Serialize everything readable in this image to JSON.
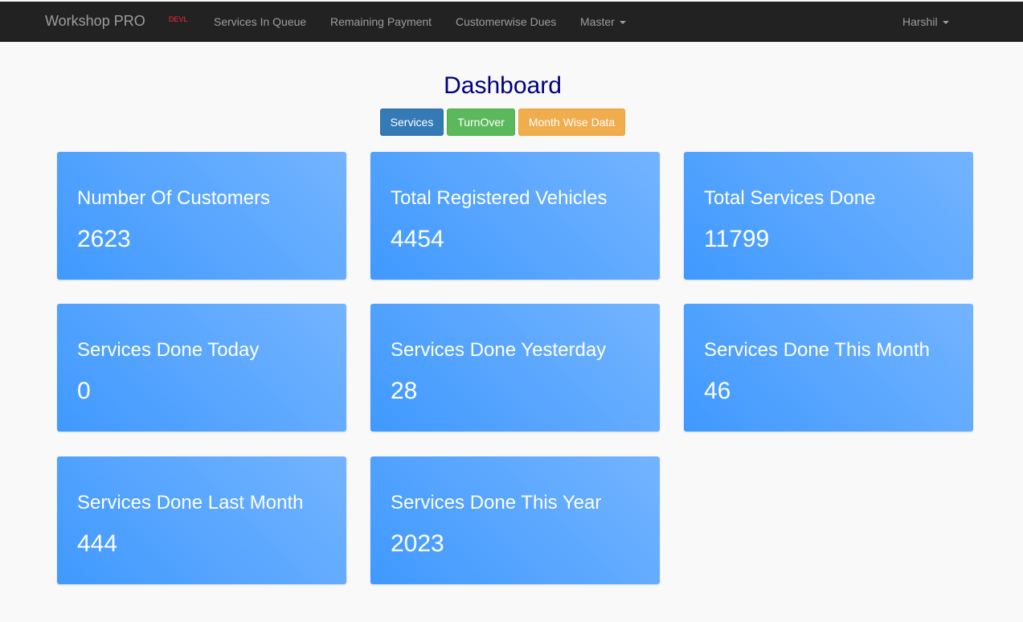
{
  "navbar": {
    "brand": "Workshop PRO",
    "env_badge": "DEVL",
    "links": [
      {
        "label": "Services In Queue"
      },
      {
        "label": "Remaining Payment"
      },
      {
        "label": "Customerwise Dues"
      },
      {
        "label": "Master"
      }
    ],
    "user": "Harshil"
  },
  "page": {
    "title": "Dashboard"
  },
  "buttons": {
    "services": "Services",
    "turnover": "TurnOver",
    "month_wise": "Month Wise Data"
  },
  "cards": [
    {
      "title": "Number Of Customers",
      "value": "2623"
    },
    {
      "title": "Total Registered Vehicles",
      "value": "4454"
    },
    {
      "title": "Total Services Done",
      "value": "11799"
    },
    {
      "title": "Services Done Today",
      "value": "0"
    },
    {
      "title": "Services Done Yesterday",
      "value": "28"
    },
    {
      "title": "Services Done This Month",
      "value": "46"
    },
    {
      "title": "Services Done Last Month",
      "value": "444"
    },
    {
      "title": "Services Done This Year",
      "value": "2023"
    }
  ],
  "colors": {
    "navbar_bg": "#222222",
    "title_color": "#000080",
    "card_gradient_start": "#4099ff",
    "card_gradient_end": "#73b4ff",
    "btn_primary": "#337ab7",
    "btn_success": "#5cb85c",
    "btn_warning": "#f0ad4e"
  }
}
